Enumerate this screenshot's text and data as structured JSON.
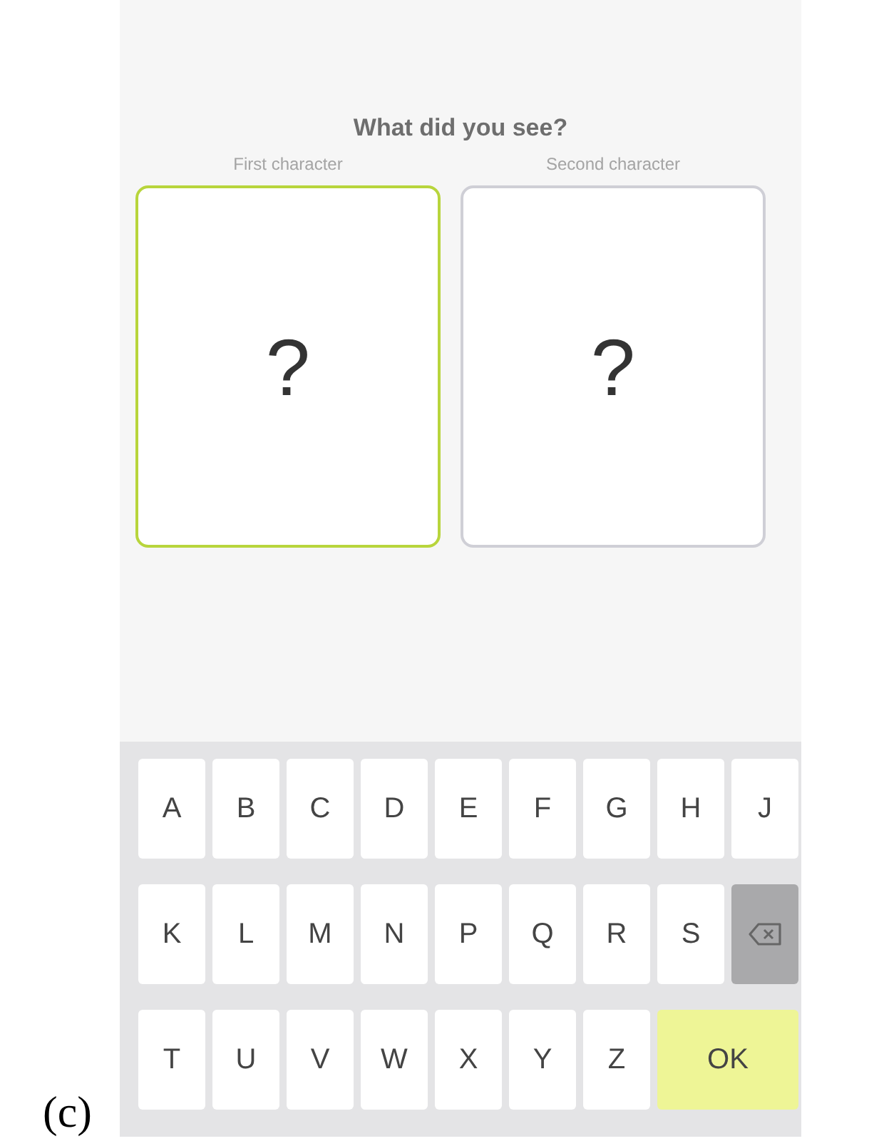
{
  "caption": "(c)",
  "screen": {
    "title": "What did you see?",
    "slots": [
      {
        "label": "First character",
        "value": "?",
        "selected": true
      },
      {
        "label": "Second character",
        "value": "?",
        "selected": false
      }
    ],
    "keyboard": [
      [
        {
          "kind": "letter",
          "label": "A"
        },
        {
          "kind": "letter",
          "label": "B"
        },
        {
          "kind": "letter",
          "label": "C"
        },
        {
          "kind": "letter",
          "label": "D"
        },
        {
          "kind": "letter",
          "label": "E"
        },
        {
          "kind": "letter",
          "label": "F"
        },
        {
          "kind": "letter",
          "label": "G"
        },
        {
          "kind": "letter",
          "label": "H"
        },
        {
          "kind": "letter",
          "label": "J"
        }
      ],
      [
        {
          "kind": "letter",
          "label": "K"
        },
        {
          "kind": "letter",
          "label": "L"
        },
        {
          "kind": "letter",
          "label": "M"
        },
        {
          "kind": "letter",
          "label": "N"
        },
        {
          "kind": "letter",
          "label": "P"
        },
        {
          "kind": "letter",
          "label": "Q"
        },
        {
          "kind": "letter",
          "label": "R"
        },
        {
          "kind": "letter",
          "label": "S"
        },
        {
          "kind": "backspace"
        }
      ],
      [
        {
          "kind": "letter",
          "label": "T"
        },
        {
          "kind": "letter",
          "label": "U"
        },
        {
          "kind": "letter",
          "label": "V"
        },
        {
          "kind": "letter",
          "label": "W"
        },
        {
          "kind": "letter",
          "label": "X"
        },
        {
          "kind": "letter",
          "label": "Y"
        },
        {
          "kind": "letter",
          "label": "Z"
        },
        {
          "kind": "ok",
          "label": "OK"
        }
      ]
    ]
  }
}
